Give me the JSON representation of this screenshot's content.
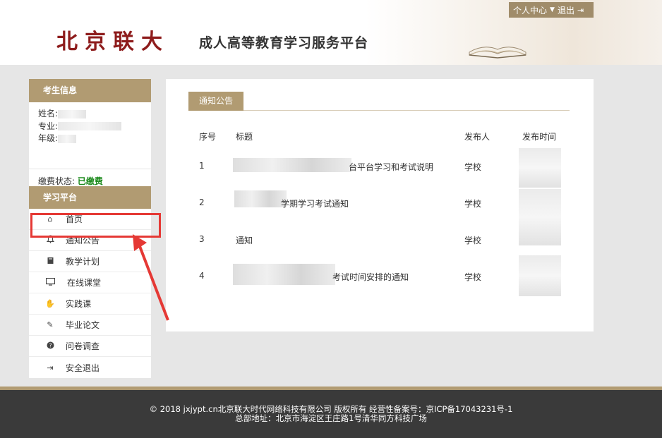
{
  "header": {
    "logo": "北京联大",
    "subtitle": "成人高等教育学习服务平台",
    "user_center": "个人中心",
    "logout": "退出"
  },
  "sidebar": {
    "student_info_title": "考生信息",
    "name_label": "姓名:",
    "major_label": "专业:",
    "grade_label": "年级:",
    "fee_label": "缴费状态:",
    "fee_status": "已缴费",
    "platform_title": "学习平台",
    "items": [
      {
        "label": "首页",
        "icon": "home-icon"
      },
      {
        "label": "通知公告",
        "icon": "bell-icon"
      },
      {
        "label": "教学计划",
        "icon": "book-icon"
      },
      {
        "label": "在线课堂",
        "icon": "monitor-icon"
      },
      {
        "label": "实践课",
        "icon": "hand-icon"
      },
      {
        "label": "毕业论文",
        "icon": "edit-icon"
      },
      {
        "label": "问卷调查",
        "icon": "question-icon"
      },
      {
        "label": "安全退出",
        "icon": "signout-icon"
      }
    ]
  },
  "main": {
    "tab": "通知公告",
    "columns": {
      "no": "序号",
      "title": "标题",
      "publisher": "发布人",
      "time": "发布时间"
    },
    "rows": [
      {
        "no": "1",
        "title": "台平台学习和考试说明",
        "publisher": "学校"
      },
      {
        "no": "2",
        "title": "学期学习考试通知",
        "publisher": "学校"
      },
      {
        "no": "3",
        "title": "通知",
        "publisher": "学校"
      },
      {
        "no": "4",
        "title": "考试时间安排的通知",
        "publisher": "学校"
      }
    ]
  },
  "footer": {
    "line1": "© 2018 jxjypt.cn北京联大时代网络科技有限公司 版权所有 经营性备案号：京ICP备17043231号-1",
    "line2": "总部地址：北京市海淀区王庄路1号清华同方科技广场"
  },
  "colors": {
    "accent": "#b19b72",
    "logo": "#8e1c1c",
    "paid": "#1c8a1c",
    "annotation": "#e53935",
    "footer": "#3a3a3a"
  }
}
